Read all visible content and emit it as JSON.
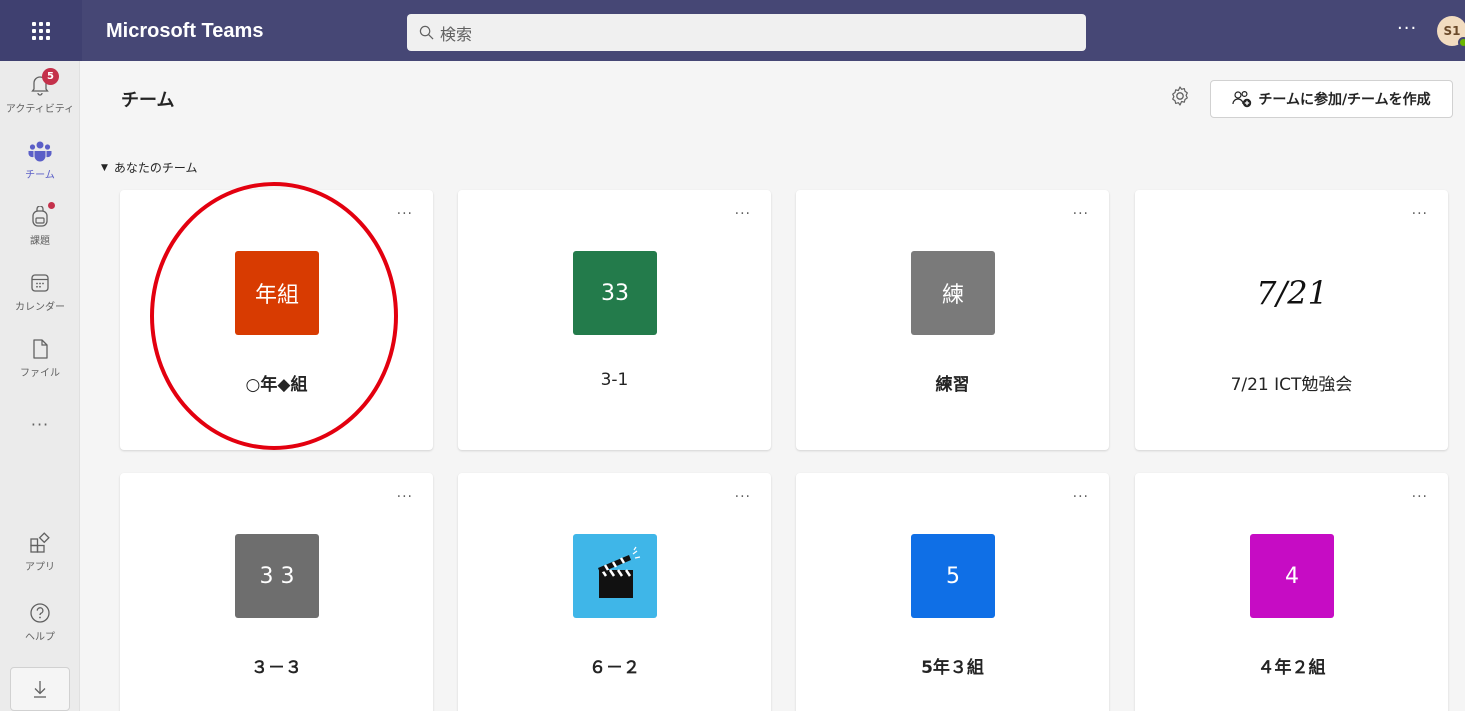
{
  "topbar": {
    "app_title": "Microsoft Teams",
    "search_placeholder": "検索",
    "more_label": "···",
    "avatar_initials": "S1",
    "color": "#464775"
  },
  "rail": {
    "items": [
      {
        "label": "アクティビティ",
        "icon": "bell-icon",
        "badge": "5"
      },
      {
        "label": "チーム",
        "icon": "teams-icon"
      },
      {
        "label": "課題",
        "icon": "backpack-icon"
      },
      {
        "label": "カレンダー",
        "icon": "calendar-icon"
      },
      {
        "label": "ファイル",
        "icon": "file-icon"
      }
    ],
    "more_label": "···",
    "apps_label": "アプリ",
    "help_label": "ヘルプ"
  },
  "main": {
    "title": "チーム",
    "join_button": "チームに参加/チームを作成",
    "section_header": "あなたのチーム"
  },
  "teams": [
    {
      "name": "○年◆組",
      "tile_text": "年組",
      "tile_color": "#d83b01"
    },
    {
      "name": "3-1",
      "tile_text": "33",
      "tile_color": "#237b4b"
    },
    {
      "name": "練習",
      "tile_text": "練",
      "tile_color": "#7a7a7a"
    },
    {
      "name": "7/21 ICT勉強会",
      "tile_text": "7/21",
      "tile_color": "#ffffff"
    },
    {
      "name": "３－３",
      "tile_text": "3 3",
      "tile_color": "#6e6e6e"
    },
    {
      "name": "６－２",
      "tile_text": "",
      "tile_color": "#3fb6e8"
    },
    {
      "name": "5年３組",
      "tile_text": "5",
      "tile_color": "#0f6fe6"
    },
    {
      "name": "４年２組",
      "tile_text": "4",
      "tile_color": "#c60cc4"
    }
  ],
  "card_more_label": "···",
  "annotation_color": "#e3000f"
}
